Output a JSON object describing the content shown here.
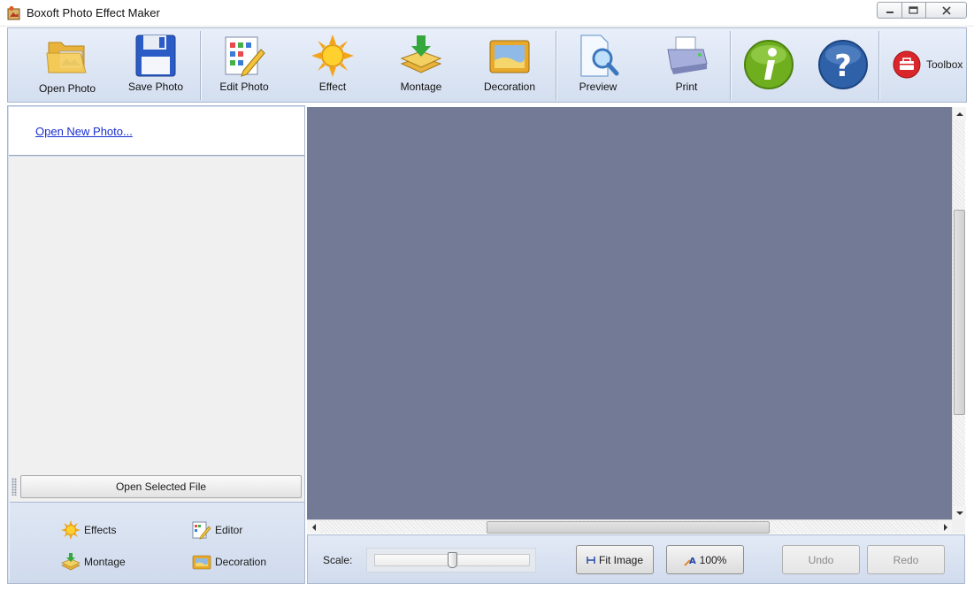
{
  "window": {
    "title": "Boxoft Photo Effect Maker"
  },
  "toolbar": {
    "open_photo": "Open Photo",
    "save_photo": "Save Photo",
    "edit_photo": "Edit Photo",
    "effect": "Effect",
    "montage": "Montage",
    "decoration": "Decoration",
    "preview": "Preview",
    "print": "Print",
    "toolbox": "Toolbox"
  },
  "left_panel": {
    "open_new_photo": "Open New Photo...",
    "open_selected_file": "Open Selected File",
    "shortcuts": {
      "effects": "Effects",
      "editor": "Editor",
      "montage": "Montage",
      "decoration": "Decoration"
    }
  },
  "bottom_bar": {
    "scale_label": "Scale:",
    "scale_value": 0.5,
    "fit_image": "Fit Image",
    "zoom_100": "100%",
    "undo": "Undo",
    "redo": "Redo"
  },
  "colors": {
    "canvas_bg": "#737a96",
    "toolbar_bg": "#d3deef",
    "link": "#1a2fcf"
  }
}
